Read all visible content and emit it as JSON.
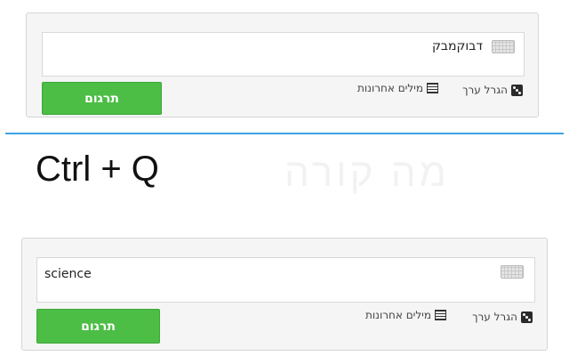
{
  "top_panel": {
    "input_value": "דבוקמבק",
    "random_entry_label": "הגרל ערך",
    "recent_words_label": "מילים אחרונות",
    "translate_label": "תרגום"
  },
  "divider_color": "#3aa3e3",
  "shortcut_text": "Ctrl + Q",
  "background_ghost_text": "מה קורה",
  "bottom_panel": {
    "input_value": "science",
    "random_entry_label": "הגרל ערך",
    "recent_words_label": "מילים אחרונות",
    "translate_label": "תרגום"
  },
  "icons": {
    "keyboard": "keyboard-icon",
    "dice": "dice-icon",
    "recent": "list-icon"
  },
  "colors": {
    "button_green": "#4cbd45",
    "panel_bg": "#f5f5f5"
  }
}
